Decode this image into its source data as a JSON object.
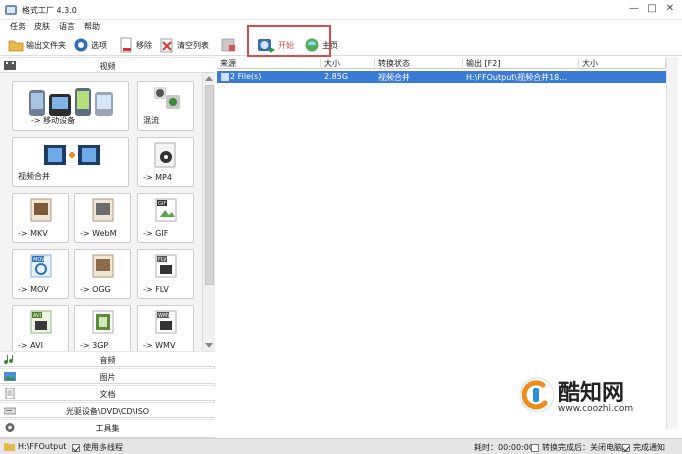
{
  "window": {
    "title": "格式工厂 4.3.0"
  },
  "menu": [
    "任务",
    "皮肤",
    "语言",
    "帮助"
  ],
  "toolbar": {
    "output_folder": "输出文件夹",
    "options": "选项",
    "remove": "移除",
    "clear_list": "清空列表",
    "start": "开始",
    "home": "主页"
  },
  "categories": {
    "video": "视频",
    "audio": "音频",
    "image": "图片",
    "document": "文档",
    "disc": "光驱设备\\DVD\\CD\\ISO",
    "toolbox": "工具集"
  },
  "tiles": [
    {
      "label": "-> 移动设备"
    },
    {
      "label": "混流"
    },
    {
      "label": "视频合并"
    },
    {
      "label": "-> MP4"
    },
    {
      "label": "-> MKV"
    },
    {
      "label": "-> WebM"
    },
    {
      "label": "-> GIF"
    },
    {
      "label": "-> MOV"
    },
    {
      "label": "-> OGG"
    },
    {
      "label": "-> FLV"
    },
    {
      "label": "-> AVI"
    },
    {
      "label": "-> 3GP"
    },
    {
      "label": "-> WMV"
    }
  ],
  "tile_badges": {
    "gif": "GIF",
    "mov": "MOV",
    "flv": "FLV",
    "avi": "AVI",
    "wmv": "WMV"
  },
  "table": {
    "columns": [
      "来源",
      "大小",
      "转换状态",
      "输出 [F2]",
      "大小"
    ],
    "rows": [
      {
        "source": "2 File(s)",
        "size": "2.85G",
        "status": "视频合并",
        "output": "H:\\FFOutput\\视频合并18...",
        "out_size": ""
      }
    ]
  },
  "watermark": {
    "text": "酷知网",
    "url": "www.coozhi.com"
  },
  "status": {
    "output_path": "H:\\FFOutput",
    "multithread": "使用多线程",
    "elapsed": "耗时：00:00:00",
    "after_convert": "转换完成后：关闭电脑",
    "notify": "完成通知"
  },
  "colors": {
    "selection": "#3a7bd5",
    "highlight_border": "#d94b4b",
    "start_text": "#d94b4b"
  }
}
